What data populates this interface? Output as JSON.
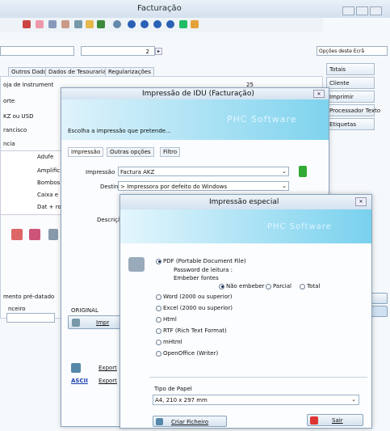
{
  "main": {
    "title": "Facturação",
    "page_field": "2",
    "tabs": [
      "Outros Dados",
      "Dados de Tesouraria",
      "Regularizações"
    ],
    "left_list": [
      "oja de Instrument",
      "orte",
      "KZ ou USD",
      "rancisco",
      "ncia"
    ],
    "instruments": [
      "Adufe",
      "Amplific",
      "Bombos",
      "Caixa e",
      "Dat + ro"
    ],
    "labels": {
      "predatado": "mento pré-datado",
      "nceiro": "nceiro",
      "value_25": "25"
    }
  },
  "right_panel": {
    "select": "Opções deste Ecrã",
    "items": [
      "Totais",
      "Cliente",
      "Imprimir",
      "Processador Texto",
      "Etiquetas"
    ]
  },
  "idu": {
    "title": "Impressão de IDU (Facturação)",
    "watermark": "PHC Software",
    "prompt": "Escolha a impressão que pretende...",
    "tabs": [
      "Impressão",
      "Outras opções",
      "Filtro"
    ],
    "impressao_label": "Impressão",
    "impressao_value": "Factura AKZ",
    "destino_label": "Destino",
    "destino_value": "> Impressora por defeito do Windows",
    "descricao_label": "Descrição",
    "original_label": "ORIGINAL",
    "imprimir": "Impr",
    "exportar1": "Export",
    "exportar2": "Export",
    "ascii": "ASCII"
  },
  "esp": {
    "title": "Impressão especial",
    "watermark": "PHC Software",
    "pdf": "PDF (Portable Document File)",
    "password": "Password de leitura :",
    "embeber": "Embeber fontes",
    "embed_options": [
      "Não embeber",
      "Parcial",
      "Total"
    ],
    "formats": [
      "Word (2000 ou superior)",
      "Excel (2000 ou superior)",
      "Html",
      "RTF (Rich Text Format)",
      "mHtml",
      "OpenOffice (Writer)"
    ],
    "paper_label": "Tipo de Papel",
    "paper_value": "A4, 210 x 297 mm",
    "criar": "Criar Ficheiro",
    "sair": "Sair"
  }
}
